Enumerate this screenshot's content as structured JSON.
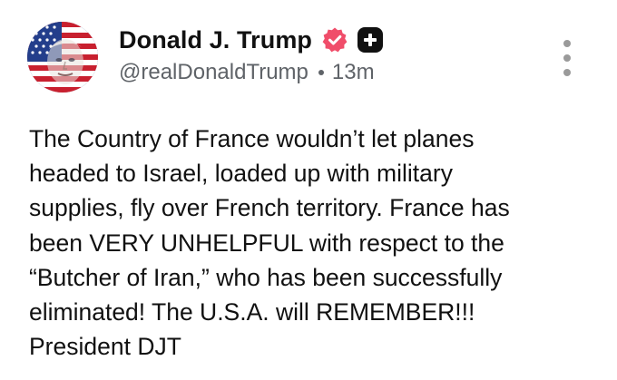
{
  "author": {
    "display_name": "Donald J. Trump",
    "handle": "@realDonaldTrump",
    "time_ago": "13m",
    "avatar_icon": "flag-portrait-avatar",
    "verified_icon": "verified-badge-icon",
    "plus_icon": "plus-badge-icon"
  },
  "post": {
    "lines": [
      "The Country of France wouldn’t let planes",
      "headed to Israel, loaded up with military",
      "supplies, fly over French territory. France has",
      "been VERY UNHELPFUL with respect to the",
      "“Butcher of Iran,” who has been successfully",
      "eliminated! The U.S.A. will REMEMBER!!!",
      "President DJT"
    ]
  },
  "menu": {
    "more_icon": "more-vertical-icon"
  },
  "colors": {
    "verified": "#f04d6a",
    "plus_badge": "#111111",
    "secondary_text": "#5f6368",
    "menu_dots": "#9a9a9a"
  }
}
